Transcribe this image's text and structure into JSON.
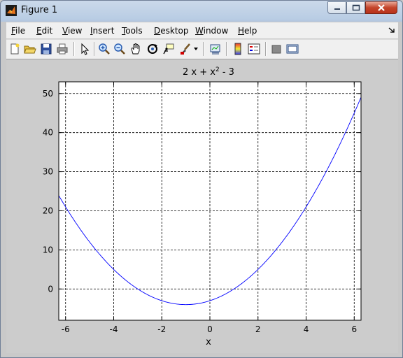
{
  "window": {
    "title": "Figure 1"
  },
  "menu": {
    "items": [
      {
        "pre": "",
        "acc": "F",
        "post": "ile"
      },
      {
        "pre": "",
        "acc": "E",
        "post": "dit"
      },
      {
        "pre": "",
        "acc": "V",
        "post": "iew"
      },
      {
        "pre": "",
        "acc": "I",
        "post": "nsert"
      },
      {
        "pre": "",
        "acc": "T",
        "post": "ools"
      },
      {
        "pre": "",
        "acc": "D",
        "post": "esktop"
      },
      {
        "pre": "",
        "acc": "W",
        "post": "indow"
      },
      {
        "pre": "",
        "acc": "H",
        "post": "elp"
      }
    ]
  },
  "toolbar": {
    "icons": [
      "new-figure-icon",
      "open-file-icon",
      "save-icon",
      "print-icon",
      "pointer-icon",
      "zoom-in-icon",
      "zoom-out-icon",
      "pan-icon",
      "rotate-3d-icon",
      "data-cursor-icon",
      "brush-icon",
      "link-plot-icon",
      "colorbar-icon",
      "legend-icon",
      "hide-plot-tools-icon",
      "show-plot-tools-icon"
    ]
  },
  "chart_data": {
    "type": "line",
    "title": "2 x + x^2 - 3",
    "title_parts": {
      "base": "2 x + x",
      "sup": "2",
      "tail": " - 3"
    },
    "xlabel": "x",
    "ylabel": "",
    "xlim": [
      -6.2832,
      6.2832
    ],
    "ylim": [
      -8,
      53
    ],
    "xticks": [
      -6,
      -4,
      -2,
      0,
      2,
      4,
      6
    ],
    "yticks": [
      0,
      10,
      20,
      30,
      40,
      50
    ],
    "grid": true,
    "series": [
      {
        "function": "2 x + x^2 - 3",
        "color": "#0000ff",
        "x": [
          -6.28,
          -5,
          -4,
          -3,
          -2,
          -1,
          0,
          1,
          2,
          3,
          4,
          5,
          6.28
        ],
        "y": [
          23.9,
          12,
          5,
          0,
          -3,
          -4,
          -3,
          0,
          5,
          12,
          21,
          32,
          48.0
        ]
      }
    ]
  }
}
